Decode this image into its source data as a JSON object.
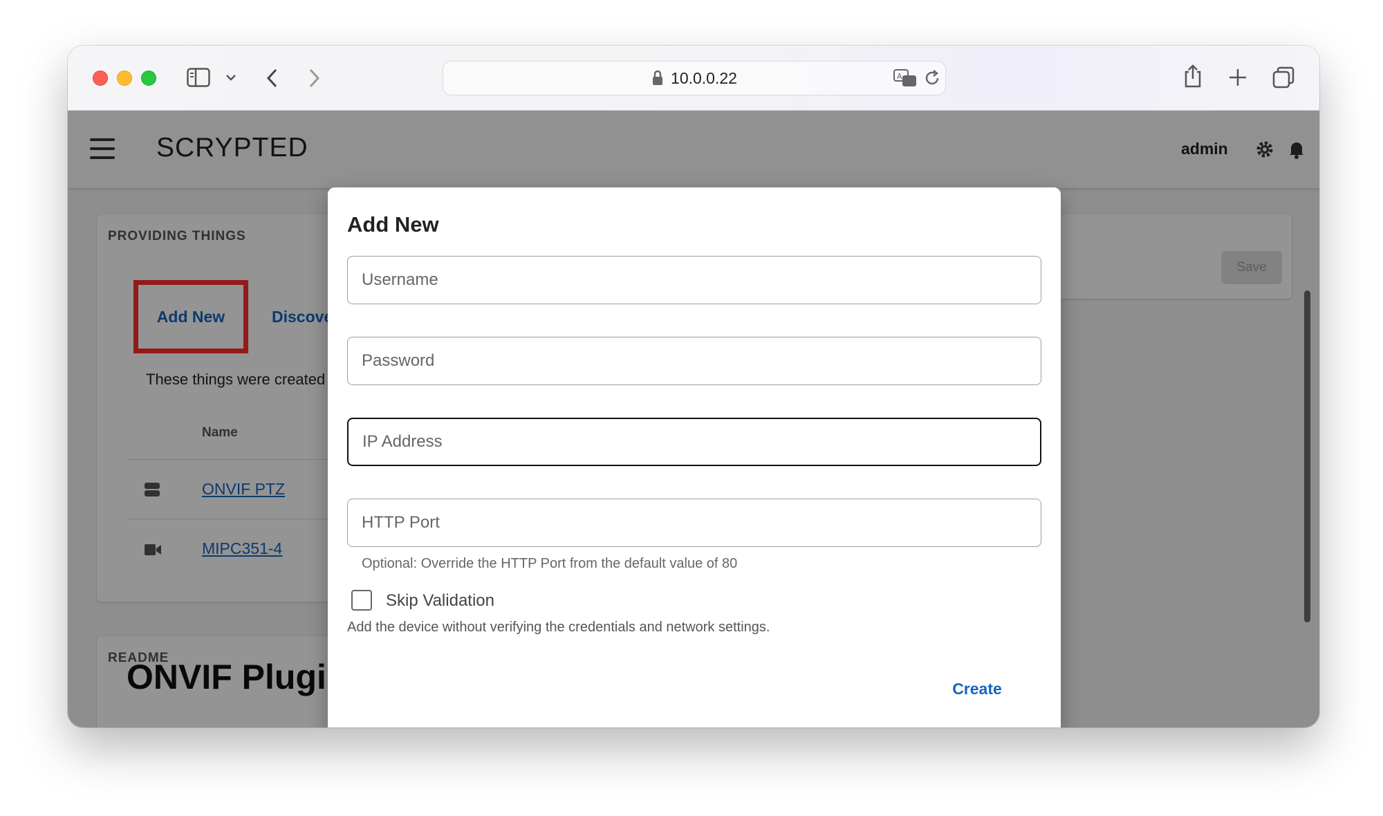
{
  "browser": {
    "url": "10.0.0.22"
  },
  "app": {
    "title": "SCRYPTED",
    "user": "admin",
    "save_label": "Save"
  },
  "providing_card": {
    "header": "PROVIDING THINGS",
    "add_new_label": "Add New",
    "discover_label": "Discove",
    "description": "These things were created",
    "column_name": "Name",
    "rows": [
      {
        "name": "ONVIF PTZ",
        "icon": "server-icon"
      },
      {
        "name": "MIPC351-4",
        "icon": "camera-icon"
      }
    ]
  },
  "readme_card": {
    "header": "README",
    "heading": "ONVIF Plugin for Scrypted"
  },
  "dialog": {
    "title": "Add New",
    "fields": {
      "username_placeholder": "Username",
      "password_placeholder": "Password",
      "ip_placeholder": "IP Address",
      "port_placeholder": "HTTP Port"
    },
    "port_hint": "Optional: Override the HTTP Port from the default value of 80",
    "skip_label": "Skip Validation",
    "skip_description": "Add the device without verifying the credentials and network settings.",
    "skip_checked": false,
    "create_label": "Create"
  },
  "colors": {
    "link_blue": "#1565c0",
    "highlight_red": "#ff2d2d"
  }
}
